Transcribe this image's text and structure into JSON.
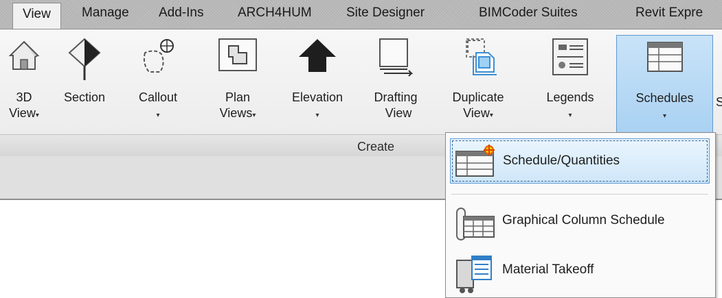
{
  "tabs": [
    {
      "label": "View",
      "active": true
    },
    {
      "label": "Manage",
      "active": false
    },
    {
      "label": "Add-Ins",
      "active": false
    },
    {
      "label": "ARCH4HUM",
      "active": false
    },
    {
      "label": "Site Designer",
      "active": false
    },
    {
      "label": "BIMCoder Suites",
      "active": false
    },
    {
      "label": "Revit Expre",
      "active": false
    }
  ],
  "ribbon": {
    "buttons": [
      {
        "line1": "3D",
        "line2": "View",
        "icon": "house-icon",
        "has_dropdown": true
      },
      {
        "line1": "Section",
        "line2": "",
        "icon": "section-marker-icon",
        "has_dropdown": false
      },
      {
        "line1": "Callout",
        "line2": "",
        "icon": "callout-icon",
        "has_dropdown": true
      },
      {
        "line1": "Plan",
        "line2": "Views",
        "icon": "plan-views-icon",
        "has_dropdown": true
      },
      {
        "line1": "Elevation",
        "line2": "",
        "icon": "elevation-arrow-icon",
        "has_dropdown": true
      },
      {
        "line1": "Drafting",
        "line2": "View",
        "icon": "drafting-view-icon",
        "has_dropdown": false
      },
      {
        "line1": "Duplicate",
        "line2": "View",
        "icon": "duplicate-view-icon",
        "has_dropdown": true
      },
      {
        "line1": "Legends",
        "line2": "",
        "icon": "legends-icon",
        "has_dropdown": true
      },
      {
        "line1": "Schedules",
        "line2": "",
        "icon": "schedules-icon",
        "has_dropdown": true,
        "pressed": true
      }
    ],
    "panel_label": "Create",
    "dropdown_caret": "▾",
    "partial_cut_text": "S"
  },
  "dropdown": {
    "items": [
      {
        "label": "Schedule/Quantities",
        "icon": "schedule-quantities-icon",
        "highlighted": true
      },
      {
        "label": "Graphical Column Schedule",
        "icon": "graphical-column-schedule-icon",
        "highlighted": false
      },
      {
        "label": "Material Takeoff",
        "icon": "material-takeoff-icon",
        "highlighted": false
      }
    ]
  },
  "colors": {
    "tabbar_bg": "#b9b9b9",
    "ribbon_bg": "#f2f2f2",
    "pressed_bg": "#b6d8f4",
    "pressed_border": "#5f98cf",
    "highlight_border": "#5c9ad6",
    "icon_blue": "#3a8fd6"
  }
}
